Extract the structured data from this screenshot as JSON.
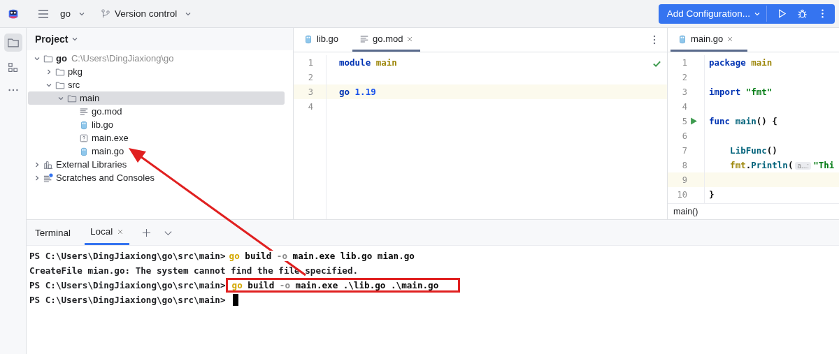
{
  "toolbar": {
    "project": "go",
    "vcs": "Version control",
    "run_config": "Add Configuration..."
  },
  "project_panel": {
    "title": "Project",
    "tree": [
      {
        "label": "go",
        "hint": "C:\\Users\\DingJiaxiong\\go",
        "kind": "folder",
        "expanded": true,
        "selected": false,
        "bold": true,
        "children": [
          {
            "label": "pkg",
            "kind": "folder",
            "expanded": false,
            "selected": false
          },
          {
            "label": "src",
            "kind": "folder",
            "expanded": true,
            "selected": false,
            "children": [
              {
                "label": "main",
                "kind": "folder",
                "expanded": true,
                "selected": true,
                "children": [
                  {
                    "label": "go.mod",
                    "kind": "mod",
                    "selected": false
                  },
                  {
                    "label": "lib.go",
                    "kind": "go",
                    "selected": false
                  },
                  {
                    "label": "main.exe",
                    "kind": "unknown",
                    "selected": false
                  },
                  {
                    "label": "main.go",
                    "kind": "go",
                    "selected": false
                  }
                ]
              }
            ]
          }
        ]
      },
      {
        "label": "External Libraries",
        "kind": "libraries",
        "expanded": false,
        "selected": false
      },
      {
        "label": "Scratches and Consoles",
        "kind": "scratches",
        "expanded": false,
        "selected": false
      }
    ]
  },
  "editors": [
    {
      "tabs": [
        {
          "label": "lib.go",
          "kind": "go",
          "selected": false,
          "closable": false
        },
        {
          "label": "go.mod",
          "kind": "mod",
          "selected": true,
          "closable": true
        }
      ],
      "checked": true,
      "lines": [
        {
          "number": "1",
          "current": false,
          "tokens": [
            {
              "text": "module ",
              "kind": "keyword"
            },
            {
              "text": "main",
              "kind": "ident"
            }
          ]
        },
        {
          "number": "2",
          "current": false
        },
        {
          "number": "3",
          "current": true,
          "tokens": [
            {
              "text": "go ",
              "kind": "keyword"
            },
            {
              "text": "1.19",
              "kind": "number"
            }
          ]
        },
        {
          "number": "4",
          "current": false
        }
      ]
    },
    {
      "tabs": [
        {
          "label": "main.go",
          "kind": "go",
          "selected": true,
          "closable": true
        }
      ],
      "checked": false,
      "breadcrumb": "main()",
      "lines": [
        {
          "number": "1",
          "current": false,
          "tokens": [
            {
              "text": "package ",
              "kind": "keyword"
            },
            {
              "text": "main",
              "kind": "ident"
            }
          ]
        },
        {
          "number": "2",
          "current": false
        },
        {
          "number": "3",
          "current": false,
          "tokens": [
            {
              "text": "import ",
              "kind": "keyword"
            },
            {
              "text": "\"fmt\"",
              "kind": "string"
            }
          ]
        },
        {
          "number": "4",
          "current": false
        },
        {
          "number": "5",
          "current": false,
          "run": true,
          "tokens": [
            {
              "text": "func ",
              "kind": "keyword"
            },
            {
              "text": "main",
              "kind": "func"
            },
            {
              "text": "() {",
              "kind": "plain"
            }
          ]
        },
        {
          "number": "6",
          "current": false
        },
        {
          "number": "7",
          "current": false,
          "tokens": [
            {
              "text": "    LibFunc",
              "kind": "func"
            },
            {
              "text": "()",
              "kind": "plain"
            }
          ]
        },
        {
          "number": "8",
          "current": false,
          "tokens": [
            {
              "text": "    fmt",
              "kind": "ident"
            },
            {
              "text": ".",
              "kind": "plain"
            },
            {
              "text": "Println",
              "kind": "func"
            },
            {
              "text": "(",
              "kind": "plain"
            },
            {
              "text": "a...:",
              "kind": "hint"
            },
            {
              "text": "\"Thi",
              "kind": "string"
            }
          ]
        },
        {
          "number": "9",
          "current": true
        },
        {
          "number": "10",
          "current": false,
          "tokens": [
            {
              "text": "}",
              "kind": "plain"
            }
          ]
        }
      ]
    }
  ],
  "terminal": {
    "title": "Terminal",
    "tabs": [
      {
        "label": "Local",
        "selected": true
      }
    ],
    "lines": [
      {
        "prompt": "PS C:\\Users\\DingJiaxiong\\go\\src\\main>",
        "highlighted": false,
        "tokens": [
          {
            "text": "go",
            "kind": "cmd"
          },
          {
            "text": " build ",
            "kind": "plain"
          },
          {
            "text": "-o",
            "kind": "flag"
          },
          {
            "text": " main.exe lib.go mian.go",
            "kind": "plain"
          }
        ]
      },
      {
        "output": "CreateFile mian.go: The system cannot find the file specified."
      },
      {
        "prompt": "PS C:\\Users\\DingJiaxiong\\go\\src\\main>",
        "highlighted": true,
        "tokens": [
          {
            "text": "go",
            "kind": "cmd"
          },
          {
            "text": " build ",
            "kind": "plain"
          },
          {
            "text": "-o",
            "kind": "flag"
          },
          {
            "text": " main.exe .\\lib.go .\\main.go",
            "kind": "plain"
          }
        ]
      },
      {
        "prompt": "PS C:\\Users\\DingJiaxiong\\go\\src\\main>",
        "cursor": true
      }
    ]
  }
}
